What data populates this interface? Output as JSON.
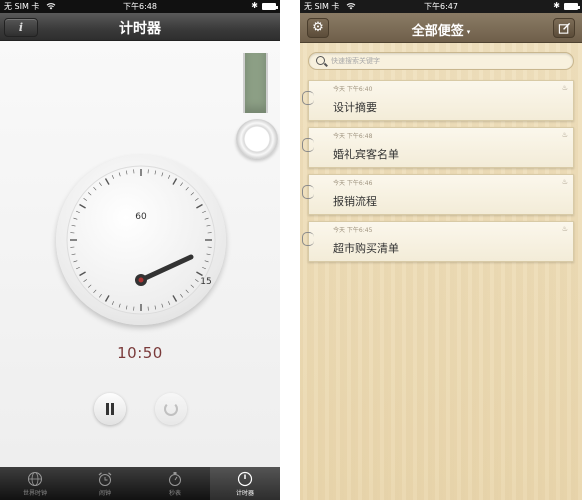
{
  "left": {
    "status": {
      "carrier": "无 SIM 卡",
      "time": "下午6:48"
    },
    "nav": {
      "info_label": "i",
      "title": "计时器"
    },
    "dial": {
      "label_top": "60",
      "label_right": "15",
      "hand_minutes": 10.8
    },
    "readout": "10:50",
    "tabs": [
      {
        "label": "世界时钟",
        "icon": "globe-icon"
      },
      {
        "label": "闹钟",
        "icon": "alarm-clock-icon"
      },
      {
        "label": "秒表",
        "icon": "stopwatch-icon"
      },
      {
        "label": "计时器",
        "icon": "timer-icon",
        "active": true
      }
    ]
  },
  "right": {
    "status": {
      "carrier": "无 SIM 卡",
      "time": "下午6:47"
    },
    "nav": {
      "title": "全部便签"
    },
    "search": {
      "placeholder": "快速搜索关键字"
    },
    "notes": [
      {
        "date": "今天 下午6:40",
        "title": "设计摘要"
      },
      {
        "date": "今天 下午6:48",
        "title": "婚礼宾客名单"
      },
      {
        "date": "今天 下午6:46",
        "title": "报销流程"
      },
      {
        "date": "今天 下午6:45",
        "title": "超市购买清单"
      }
    ]
  },
  "colors": {
    "readout": "#7a3a3a",
    "strap": "#8c9f85",
    "wood": "#efe0bd"
  }
}
